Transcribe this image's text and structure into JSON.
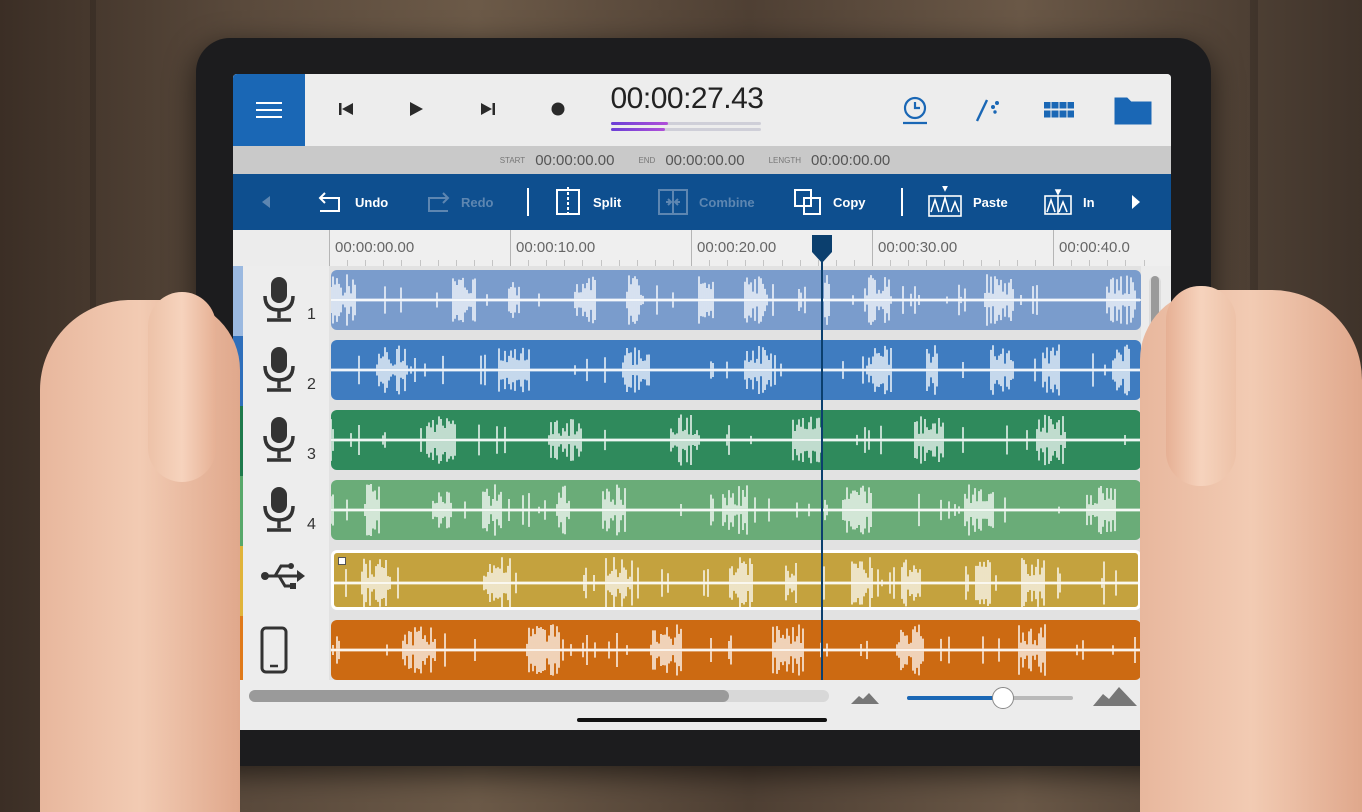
{
  "transport": {
    "timecode": "00:00:27.43",
    "level_fill": 0.38
  },
  "info": {
    "start_label": "START",
    "start_value": "00:00:00.00",
    "end_label": "END",
    "end_value": "00:00:00.00",
    "length_label": "LENGTH",
    "length_value": "00:00:00.00"
  },
  "edit_toolbar": {
    "undo": "Undo",
    "redo": "Redo",
    "split": "Split",
    "combine": "Combine",
    "copy": "Copy",
    "paste": "Paste",
    "insert": "In"
  },
  "ruler": {
    "labels": [
      "00:00:00.00",
      "00:00:10.00",
      "00:00:20.00",
      "00:00:30.00",
      "00:00:40.0"
    ]
  },
  "tracks": [
    {
      "number": "1",
      "icon": "microphone-icon",
      "color": "#7a9ccc",
      "stripe": "#9bb9e0"
    },
    {
      "number": "2",
      "icon": "microphone-icon",
      "color": "#3f7cc0",
      "stripe": "#2f6fbb"
    },
    {
      "number": "3",
      "icon": "microphone-icon",
      "color": "#2f8a5c",
      "stripe": "#1f7a4c"
    },
    {
      "number": "4",
      "icon": "microphone-icon",
      "color": "#6aac78",
      "stripe": "#58a86a"
    },
    {
      "number": "",
      "icon": "usb-icon",
      "color": "#c4a23e",
      "stripe": "#e0b43a"
    },
    {
      "number": "",
      "icon": "phone-icon",
      "color": "#cc6a12",
      "stripe": "#e07a1a"
    }
  ],
  "zoom": {
    "level": 0.58
  },
  "colors": {
    "accent": "#1a67b5",
    "toolbar": "#0e4f8f"
  }
}
